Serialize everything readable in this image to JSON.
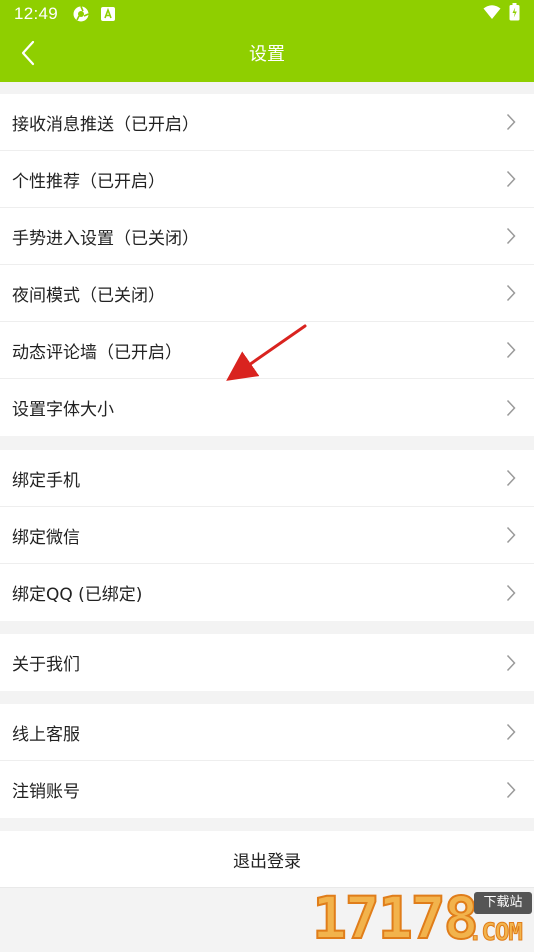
{
  "status_bar": {
    "time": "12:49"
  },
  "app_bar": {
    "title": "设置"
  },
  "groups": [
    {
      "items": [
        {
          "label": "接收消息推送（已开启）"
        },
        {
          "label": "个性推荐（已开启）"
        },
        {
          "label": "手势进入设置（已关闭）"
        },
        {
          "label": "夜间模式（已关闭）"
        },
        {
          "label": "动态评论墙（已开启）"
        },
        {
          "label": "设置字体大小"
        }
      ]
    },
    {
      "items": [
        {
          "label": "绑定手机"
        },
        {
          "label": "绑定微信"
        },
        {
          "label": "绑定QQ (已绑定)"
        }
      ]
    },
    {
      "items": [
        {
          "label": "关于我们"
        }
      ]
    },
    {
      "items": [
        {
          "label": "线上客服"
        },
        {
          "label": "注销账号"
        }
      ]
    }
  ],
  "logout_label": "退出登录",
  "watermark": {
    "number": "17178",
    "badge": "下载站",
    "suffix": ".COM"
  },
  "colors": {
    "accent": "#8fcf00",
    "annotation_arrow": "#d9231f"
  }
}
